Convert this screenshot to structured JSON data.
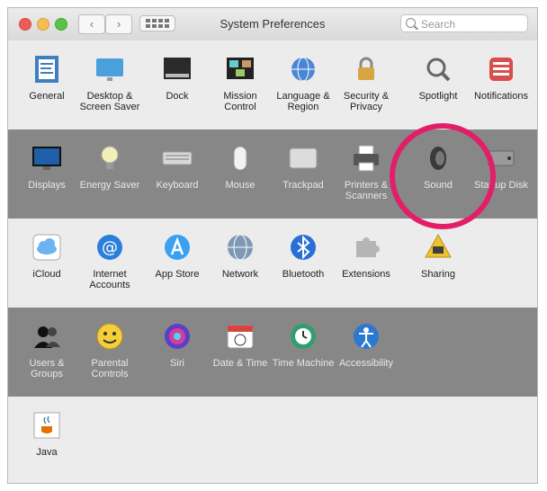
{
  "window": {
    "title": "System Preferences",
    "search_placeholder": "Search",
    "back_glyph": "‹",
    "forward_glyph": "›"
  },
  "rows": [
    {
      "items": [
        {
          "label": "General",
          "icon": "general-icon"
        },
        {
          "label": "Desktop & Screen Saver",
          "icon": "desktop-icon"
        },
        {
          "label": "Dock",
          "icon": "dock-icon"
        },
        {
          "label": "Mission Control",
          "icon": "mission-control-icon"
        },
        {
          "label": "Language & Region",
          "icon": "globe-icon"
        },
        {
          "label": "Security & Privacy",
          "icon": "lock-icon"
        },
        {
          "label": "Spotlight",
          "icon": "spotlight-icon"
        },
        {
          "label": "Notifications",
          "icon": "notifications-icon"
        }
      ]
    },
    {
      "items": [
        {
          "label": "Displays",
          "icon": "display-icon"
        },
        {
          "label": "Energy Saver",
          "icon": "bulb-icon"
        },
        {
          "label": "Keyboard",
          "icon": "keyboard-icon"
        },
        {
          "label": "Mouse",
          "icon": "mouse-icon"
        },
        {
          "label": "Trackpad",
          "icon": "trackpad-icon"
        },
        {
          "label": "Printers & Scanners",
          "icon": "printer-icon"
        },
        {
          "label": "Sound",
          "icon": "speaker-icon"
        },
        {
          "label": "Startup Disk",
          "icon": "disk-icon"
        }
      ]
    },
    {
      "items": [
        {
          "label": "iCloud",
          "icon": "cloud-icon"
        },
        {
          "label": "Internet Accounts",
          "icon": "at-icon"
        },
        {
          "label": "App Store",
          "icon": "appstore-icon"
        },
        {
          "label": "Network",
          "icon": "network-globe-icon"
        },
        {
          "label": "Bluetooth",
          "icon": "bluetooth-icon"
        },
        {
          "label": "Extensions",
          "icon": "puzzle-icon"
        },
        {
          "label": "Sharing",
          "icon": "sharing-icon"
        }
      ]
    },
    {
      "items": [
        {
          "label": "Users & Groups",
          "icon": "users-icon"
        },
        {
          "label": "Parental Controls",
          "icon": "parental-icon"
        },
        {
          "label": "Siri",
          "icon": "siri-icon"
        },
        {
          "label": "Date & Time",
          "icon": "calendar-clock-icon"
        },
        {
          "label": "Time Machine",
          "icon": "time-machine-icon"
        },
        {
          "label": "Accessibility",
          "icon": "accessibility-icon"
        }
      ]
    },
    {
      "items": [
        {
          "label": "Java",
          "icon": "java-icon"
        }
      ]
    }
  ],
  "highlight": {
    "target": "Sound",
    "color": "#e31e69"
  },
  "colors": {
    "dark_row": "#878787",
    "light_row": "#ececec"
  }
}
